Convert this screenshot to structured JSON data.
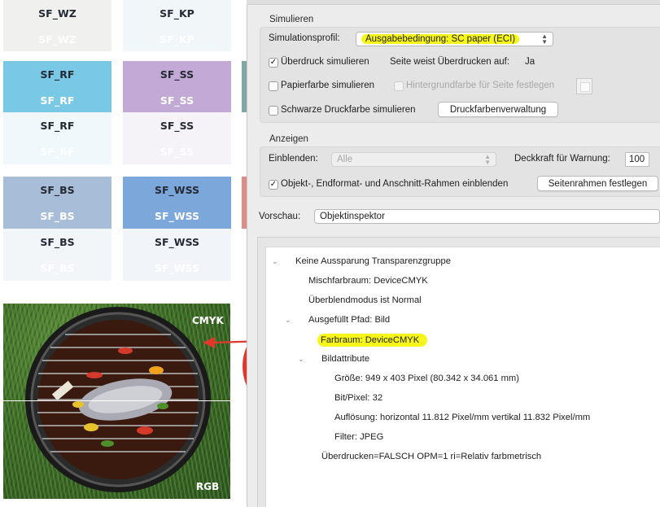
{
  "document": {
    "swatch_rows": [
      {
        "items": [
          {
            "label_top": "SF_WZ",
            "label_bottom": "SF_WZ"
          },
          {
            "label_top": "SF_KP",
            "label_bottom": "SF_KP"
          }
        ]
      },
      {
        "items": [
          {
            "label_top": "SF_RF",
            "label_bottom": "SF_RF",
            "label_third": "SF_RF",
            "label_fourth": "SF_RF"
          },
          {
            "label_top": "SF_SS",
            "label_bottom": "SF_SS",
            "label_third": "SF_SS",
            "label_fourth": "SF_SS"
          }
        ]
      },
      {
        "items": [
          {
            "label_top": "SF_BS",
            "label_bottom": "SF_BS",
            "label_third": "SF_BS",
            "label_fourth": "SF_BS"
          },
          {
            "label_top": "SF_WSS",
            "label_bottom": "SF_WSS",
            "label_third": "SF_WSS",
            "label_fourth": "SF_WSS"
          }
        ]
      }
    ],
    "photo": {
      "label_cmyk": "CMYK",
      "label_rgb": "RGB"
    }
  },
  "dialog": {
    "simulate": {
      "section_title": "Simulieren",
      "profile_label": "Simulationsprofil:",
      "profile_value": "Ausgabebedingung: SC paper (ECI)",
      "overprint_label": "Überdruck simulieren",
      "overprint_checked": "✓",
      "page_overprint_label": "Seite weist Überdrucken auf:",
      "page_overprint_value": "Ja",
      "paper_color_label": "Papierfarbe simulieren",
      "bg_color_label": "Hintergrundfarbe für Seite festlegen",
      "black_ink_label": "Schwarze Druckfarbe simulieren",
      "ink_manager_button": "Druckfarbenverwaltung"
    },
    "display": {
      "section_title": "Anzeigen",
      "show_label": "Einblenden:",
      "show_value": "Alle",
      "opacity_label": "Deckkraft für Warnung:",
      "opacity_value": "100",
      "frames_label": "Objekt-, Endformat- und Anschnitt-Rahmen einblenden",
      "frames_checked": "✓",
      "page_frames_button": "Seitenrahmen festlegen"
    },
    "preview": {
      "label": "Vorschau:",
      "value": "Objektinspektor"
    },
    "tree": [
      "Keine Aussparung Transparenzgruppe",
      "Mischfarbraum: DeviceCMYK",
      "Überblendmodus ist Normal",
      "Ausgefüllt Pfad: Bild",
      "Farbraum: DeviceCMYK",
      "Bildattribute",
      "Größe: 949 x 403 Pixel (80.342 x 34.061 mm)",
      "Bit/Pixel: 32",
      "Auflösung: horizontal 11.812 Pixel/mm vertikal 11.832 Pixel/mm",
      "Filter: JPEG",
      "Überdrucken=FALSCH OPM=1 ri=Relativ farbmetrisch"
    ]
  },
  "colors": {
    "highlight": "#f7f61a",
    "annotation_arrow": "#e0392b",
    "rf": "#79c9e6",
    "ss": "#c2a9d6",
    "bs": "#a8bdd7",
    "wss": "#7ca7da"
  }
}
